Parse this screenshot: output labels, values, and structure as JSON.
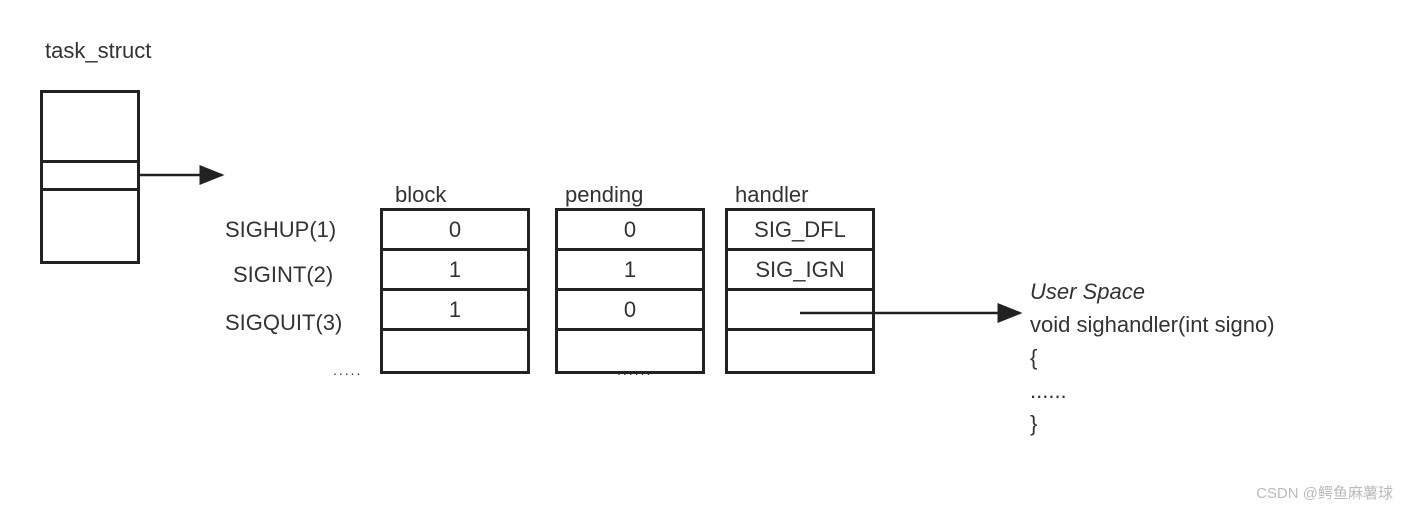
{
  "title": "task_struct",
  "columns": {
    "block": "block",
    "pending": "pending",
    "handler": "handler"
  },
  "rows": {
    "sighup": "SIGHUP(1)",
    "sigint": "SIGINT(2)",
    "sigquit": "SIGQUIT(3)"
  },
  "block_vals": [
    "0",
    "1",
    "1"
  ],
  "pending_vals": [
    "0",
    "1",
    "0"
  ],
  "handler_vals": [
    "SIG_DFL",
    "SIG_IGN",
    ""
  ],
  "dots1": ".....",
  "dots2": "......",
  "user_space": {
    "title": "User Space",
    "line1": "void sighandler(int signo)",
    "line2": "{",
    "line3": "......",
    "line4": "}"
  },
  "watermark": "CSDN @鳄鱼麻薯球"
}
